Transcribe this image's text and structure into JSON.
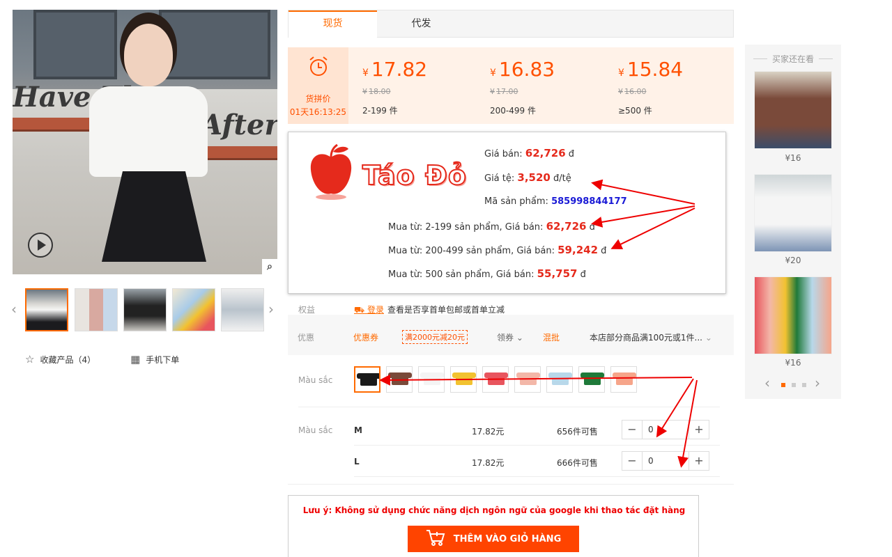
{
  "gallery": {
    "wall_text_1": "Have The",
    "wall_text_2": "After",
    "play_icon": "play-icon",
    "zoom_icon": "magnifier-icon",
    "actions": {
      "favorite_label": "收藏产品（4）",
      "mobile_label": "手机下单"
    }
  },
  "tabs": [
    {
      "label": "现货"
    },
    {
      "label": "代发"
    }
  ],
  "deal": {
    "label": "货拼价",
    "timer": "01天16:13:25"
  },
  "price_tiers": [
    {
      "currency": "¥",
      "price": "17.82",
      "old_price": "18.00",
      "range": "2-199 件"
    },
    {
      "currency": "¥",
      "price": "16.83",
      "old_price": "17.00",
      "range": "200-499 件"
    },
    {
      "currency": "¥",
      "price": "15.84",
      "old_price": "16.00",
      "range": "≥500 件"
    }
  ],
  "tao": {
    "brand": "Táo Đỏ",
    "sale_label": "Giá bán:",
    "sale_value": "62,726",
    "sale_unit": "đ",
    "rate_label": "Giá tệ:",
    "rate_value": "3,520",
    "rate_unit": "đ/tệ",
    "code_label": "Mã sản phẩm:",
    "code_value": "585998844177",
    "tiers": [
      {
        "text": "Mua từ: 2-199 sản phẩm, Giá bán:",
        "value": "62,726",
        "unit": "đ"
      },
      {
        "text": "Mua từ: 200-499 sản phẩm, Giá bán:",
        "value": "59,242",
        "unit": "đ"
      },
      {
        "text": "Mua từ: 500 sản phẩm, Giá bán:",
        "value": "55,757",
        "unit": "đ"
      }
    ]
  },
  "benefits": {
    "label": "权益",
    "login": "登录",
    "text": "查看是否享首单包邮或首单立减"
  },
  "promo": {
    "label": "优惠",
    "coupon": "优惠券",
    "coupon_tag": "满2000元减20元",
    "get_coupon": "领券",
    "mixed": "混批",
    "desc": "本店部分商品满100元或1件..."
  },
  "sku": {
    "color_label": "Màu sắc",
    "size_label": "Màu sắc",
    "swatches": [
      "#1a1a1a",
      "#7a4a3a",
      "#f4f4f4",
      "#f2c230",
      "#e8555e",
      "#f3b7a8",
      "#b8d8ea",
      "#1f7a3a",
      "#f6a58a"
    ],
    "rows": [
      {
        "size": "M",
        "price": "17.82元",
        "stock": "656件可售",
        "qty": "0"
      },
      {
        "size": "L",
        "price": "17.82元",
        "stock": "666件可售",
        "qty": "0"
      }
    ]
  },
  "side": {
    "title": "买家还在看",
    "items": [
      {
        "price": "¥16"
      },
      {
        "price": "¥20"
      },
      {
        "price": "¥16"
      }
    ]
  },
  "note": {
    "text": "Lưu ý: Không sử dụng chức năng dịch ngôn ngữ của google khi thao tác đặt hàng",
    "cart_label": "THÊM VÀO GIỎ HÀNG"
  },
  "colors": {
    "accent": "#ff6a00",
    "price": "#ff5000",
    "red": "#e52a1c",
    "link": "#1a1ad6"
  }
}
